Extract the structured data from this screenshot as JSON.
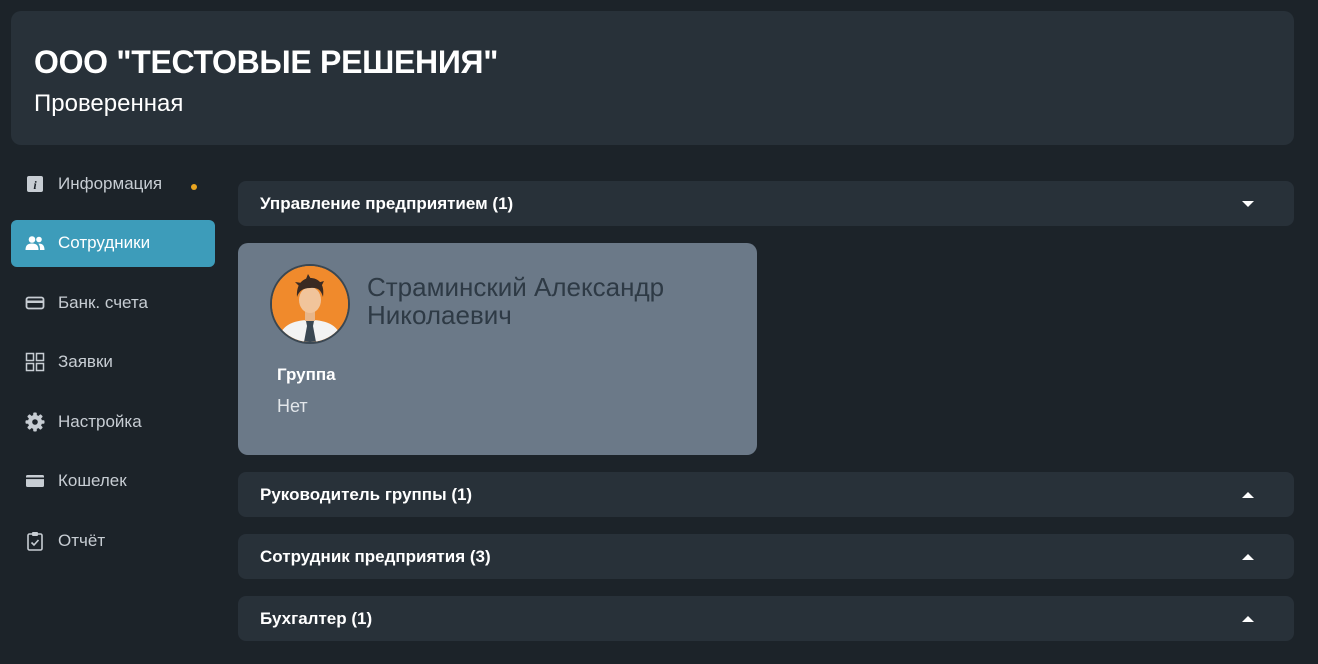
{
  "header": {
    "title": "ООО \"ТЕСТОВЫЕ РЕШЕНИЯ\"",
    "subtitle": "Проверенная"
  },
  "sidebar": {
    "items": [
      {
        "label": "Информация",
        "icon": "info-icon",
        "active": false,
        "badge": true
      },
      {
        "label": "Сотрудники",
        "icon": "users-icon",
        "active": true
      },
      {
        "label": "Банк. счета",
        "icon": "card-icon",
        "active": false
      },
      {
        "label": "Заявки",
        "icon": "apps-grid-icon",
        "active": false
      },
      {
        "label": "Настройка",
        "icon": "gear-icon",
        "active": false
      },
      {
        "label": "Кошелек",
        "icon": "wallet-icon",
        "active": false
      },
      {
        "label": "Отчёт",
        "icon": "clipboard-icon",
        "active": false
      }
    ],
    "badge_color": "#e9a520",
    "active_color": "#3d9cba"
  },
  "sections": [
    {
      "label": "Управление предприятием (1)",
      "expanded": true
    },
    {
      "label": "Руководитель группы (1)",
      "expanded": false
    },
    {
      "label": "Сотрудник предприятия (3)",
      "expanded": false
    },
    {
      "label": "Бухгалтер (1)",
      "expanded": false
    }
  ],
  "employee_card": {
    "name": "Страминский Александр Николаевич",
    "group_label": "Группа",
    "group_value": "Нет",
    "avatar_icon": "person-avatar-icon"
  }
}
